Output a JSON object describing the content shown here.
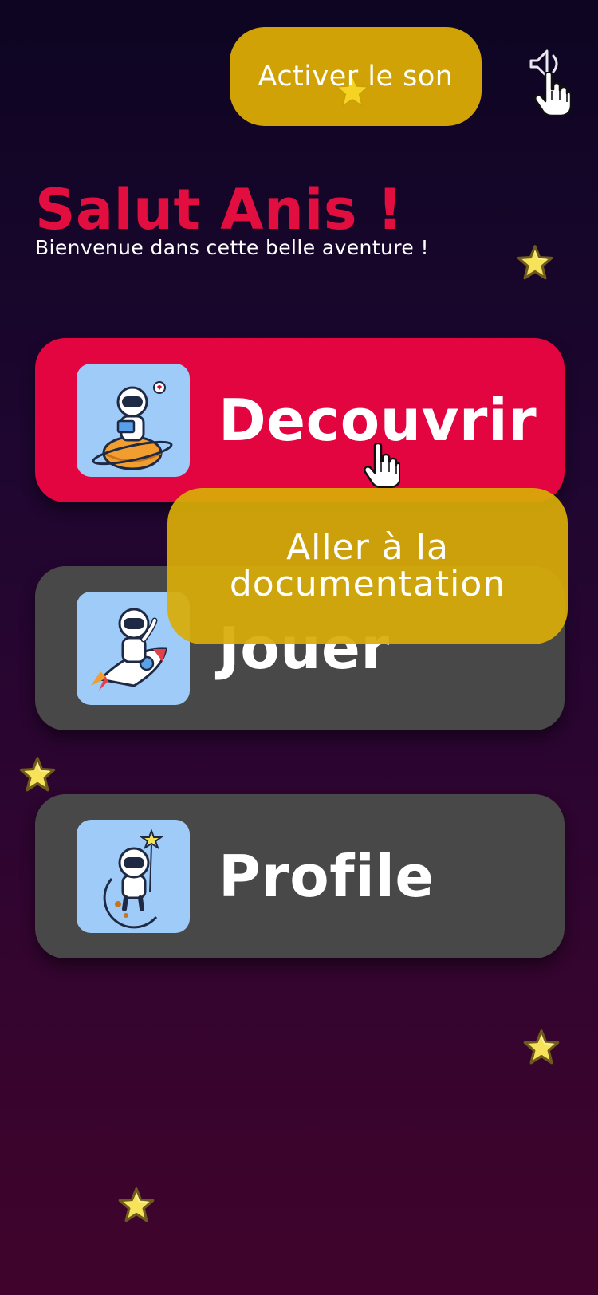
{
  "header": {
    "sound_tooltip": "Activer le son",
    "sound_icon": "speaker-icon"
  },
  "greeting": {
    "title": "Salut Anis !",
    "subtitle": "Bienvenue dans cette belle aventure !"
  },
  "menu": [
    {
      "label": "Decouvrir",
      "icon": "astronaut-on-planet-reading",
      "active": true
    },
    {
      "label": "Jouer",
      "icon": "astronaut-on-rocket",
      "active": false
    },
    {
      "label": "Profile",
      "icon": "astronaut-on-moon-with-star",
      "active": false
    }
  ],
  "doc_tooltip": {
    "line1": "Aller à la",
    "line2": "documentation"
  },
  "colors": {
    "accent_red": "#e20540",
    "card_grey": "#484848",
    "tooltip_gold": "#d0a206",
    "thumb_blue": "#9ecbf8",
    "star_yellow": "#f7e35a"
  }
}
